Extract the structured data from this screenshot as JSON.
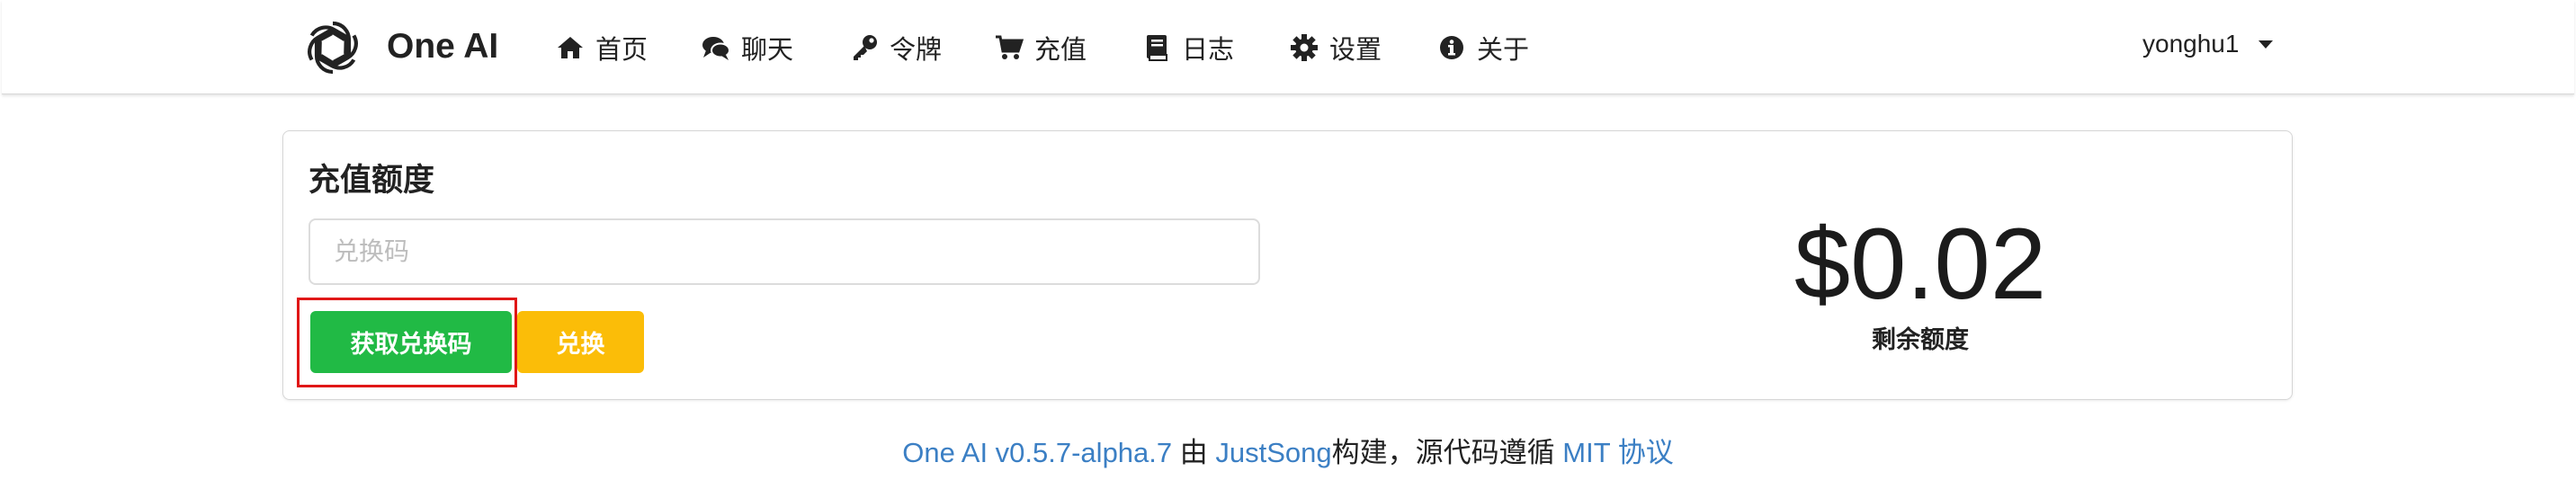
{
  "header": {
    "brand": "One AI",
    "nav": [
      {
        "label": "首页",
        "icon": "home-icon"
      },
      {
        "label": "聊天",
        "icon": "comments-icon"
      },
      {
        "label": "令牌",
        "icon": "key-icon"
      },
      {
        "label": "充值",
        "icon": "cart-icon"
      },
      {
        "label": "日志",
        "icon": "book-icon"
      },
      {
        "label": "设置",
        "icon": "gear-icon"
      },
      {
        "label": "关于",
        "icon": "info-icon"
      }
    ],
    "user": "yonghu1"
  },
  "topup": {
    "title": "充值额度",
    "code_placeholder": "兑换码",
    "code_value": "",
    "get_code_label": "获取兑换码",
    "redeem_label": "兑换",
    "balance": "$0.02",
    "balance_label": "剩余额度",
    "highlight_color": "#e01717"
  },
  "footer": {
    "project": "One AI v0.5.7-alpha.7",
    "by": "由",
    "author": "JustSong",
    "text": "构建，源代码遵循",
    "license": "MIT 协议"
  },
  "colors": {
    "primary_green": "#21ba45",
    "warning_yellow": "#fbbd08",
    "link_blue": "#3b7fc4"
  }
}
